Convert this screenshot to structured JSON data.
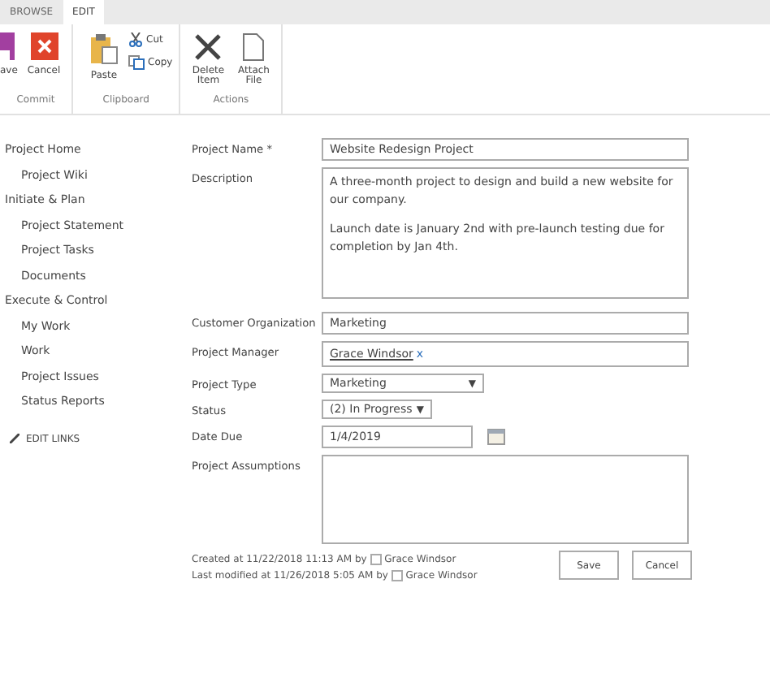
{
  "ribbon": {
    "tabs": [
      {
        "label": "BROWSE",
        "selected": false
      },
      {
        "label": "EDIT",
        "selected": true
      }
    ],
    "groups": [
      {
        "name": "Commit",
        "buttons": [
          {
            "kind": "save",
            "label": "ave"
          },
          {
            "kind": "cancel",
            "label": "Cancel"
          }
        ]
      },
      {
        "name": "Clipboard",
        "buttons": [
          {
            "kind": "paste",
            "label": "Paste"
          },
          {
            "kind": "cut",
            "label": "Cut"
          },
          {
            "kind": "copy",
            "label": "Copy"
          }
        ]
      },
      {
        "name": "Actions",
        "buttons": [
          {
            "kind": "delete",
            "label": "Delete Item"
          },
          {
            "kind": "attach",
            "label": "Attach File"
          }
        ]
      }
    ]
  },
  "sidebar": {
    "items": [
      {
        "label": "Project Home",
        "children": [
          {
            "label": "Project Wiki"
          }
        ]
      },
      {
        "label": "Initiate & Plan",
        "children": [
          {
            "label": "Project Statement"
          },
          {
            "label": "Project Tasks"
          },
          {
            "label": "Documents"
          }
        ]
      },
      {
        "label": "Execute & Control",
        "children": [
          {
            "label": "My Work"
          },
          {
            "label": "Work"
          },
          {
            "label": "Project Issues"
          },
          {
            "label": "Status Reports"
          }
        ]
      }
    ],
    "edit_links": "EDIT LINKS"
  },
  "form": {
    "fields": [
      {
        "kind": "text",
        "label": "Project Name *",
        "value": "Website Redesign Project"
      },
      {
        "kind": "textarea",
        "label": "Description",
        "paragraphs": [
          "A three-month project to design and build a new website for our company.",
          "Launch date is January 2nd with pre-launch testing due for completion by Jan 4th."
        ]
      },
      {
        "kind": "text",
        "label": "Customer Organization",
        "value": "Marketing"
      },
      {
        "kind": "person",
        "label": "Project Manager",
        "value": "Grace Windsor",
        "remove": "x"
      },
      {
        "kind": "select",
        "label": "Project Type",
        "value": "Marketing",
        "arrow": "▼"
      },
      {
        "kind": "select-small",
        "label": "Status",
        "value": "(2) In Progress",
        "arrow": "▼"
      },
      {
        "kind": "date",
        "label": "Date Due",
        "value": "1/4/2019"
      },
      {
        "kind": "textarea",
        "label": "Project Assumptions"
      }
    ],
    "created": {
      "text": "Created at 11/22/2018 11:13 AM  by",
      "user": "Grace Windsor"
    },
    "modified": {
      "text": "Last modified at 11/26/2018 5:05 AM  by",
      "user": "Grace Windsor"
    },
    "buttons": [
      "Save",
      "Cancel"
    ]
  }
}
